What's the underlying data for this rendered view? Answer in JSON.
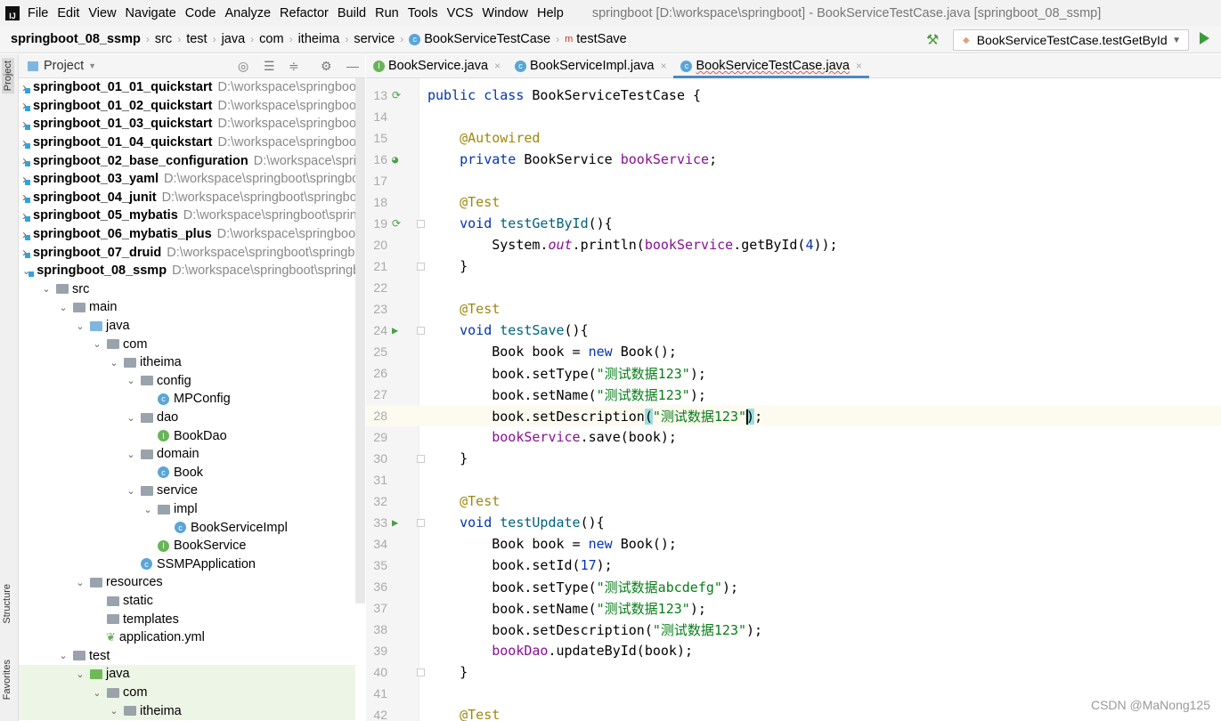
{
  "menubar": {
    "items": [
      "File",
      "Edit",
      "View",
      "Navigate",
      "Code",
      "Analyze",
      "Refactor",
      "Build",
      "Run",
      "Tools",
      "VCS",
      "Window",
      "Help"
    ],
    "title": "springboot [D:\\workspace\\springboot] - BookServiceTestCase.java [springboot_08_ssmp]"
  },
  "breadcrumb": [
    "springboot_08_ssmp",
    "src",
    "test",
    "java",
    "com",
    "itheima",
    "service",
    "BookServiceTestCase",
    "testSave"
  ],
  "run_config": "BookServiceTestCase.testGetById",
  "side_tabs": {
    "project": "Project",
    "structure": "Structure",
    "favorites": "Favorites"
  },
  "project_panel": {
    "title": "Project"
  },
  "tree": [
    {
      "label": "springboot_01_01_quickstart",
      "path": "D:\\workspace\\springboot",
      "depth": 0,
      "exp": false,
      "icon": "mod",
      "bold": true
    },
    {
      "label": "springboot_01_02_quickstart",
      "path": "D:\\workspace\\springboot",
      "depth": 0,
      "exp": false,
      "icon": "mod",
      "bold": true
    },
    {
      "label": "springboot_01_03_quickstart",
      "path": "D:\\workspace\\springboot",
      "depth": 0,
      "exp": false,
      "icon": "mod",
      "bold": true
    },
    {
      "label": "springboot_01_04_quickstart",
      "path": "D:\\workspace\\springboot",
      "depth": 0,
      "exp": false,
      "icon": "mod",
      "bold": true
    },
    {
      "label": "springboot_02_base_configuration",
      "path": "D:\\workspace\\springboot",
      "depth": 0,
      "exp": false,
      "icon": "mod",
      "bold": true
    },
    {
      "label": "springboot_03_yaml",
      "path": "D:\\workspace\\springboot\\springboot",
      "depth": 0,
      "exp": false,
      "icon": "mod",
      "bold": true
    },
    {
      "label": "springboot_04_junit",
      "path": "D:\\workspace\\springboot\\springboot",
      "depth": 0,
      "exp": false,
      "icon": "mod",
      "bold": true
    },
    {
      "label": "springboot_05_mybatis",
      "path": "D:\\workspace\\springboot\\springboot",
      "depth": 0,
      "exp": false,
      "icon": "mod",
      "bold": true
    },
    {
      "label": "springboot_06_mybatis_plus",
      "path": "D:\\workspace\\springboot",
      "depth": 0,
      "exp": false,
      "icon": "mod",
      "bold": true
    },
    {
      "label": "springboot_07_druid",
      "path": "D:\\workspace\\springboot\\springboot",
      "depth": 0,
      "exp": false,
      "icon": "mod",
      "bold": true
    },
    {
      "label": "springboot_08_ssmp",
      "path": "D:\\workspace\\springboot\\springboot",
      "depth": 0,
      "exp": true,
      "icon": "mod",
      "bold": true
    },
    {
      "label": "src",
      "depth": 1,
      "exp": true,
      "icon": "folder"
    },
    {
      "label": "main",
      "depth": 2,
      "exp": true,
      "icon": "folder"
    },
    {
      "label": "java",
      "depth": 3,
      "exp": true,
      "icon": "src"
    },
    {
      "label": "com",
      "depth": 4,
      "exp": true,
      "icon": "folder"
    },
    {
      "label": "itheima",
      "depth": 5,
      "exp": true,
      "icon": "folder"
    },
    {
      "label": "config",
      "depth": 6,
      "exp": true,
      "icon": "folder"
    },
    {
      "label": "MPConfig",
      "depth": 7,
      "icon": "class"
    },
    {
      "label": "dao",
      "depth": 6,
      "exp": true,
      "icon": "folder"
    },
    {
      "label": "BookDao",
      "depth": 7,
      "icon": "interface"
    },
    {
      "label": "domain",
      "depth": 6,
      "exp": true,
      "icon": "folder"
    },
    {
      "label": "Book",
      "depth": 7,
      "icon": "class"
    },
    {
      "label": "service",
      "depth": 6,
      "exp": true,
      "icon": "folder"
    },
    {
      "label": "impl",
      "depth": 7,
      "exp": true,
      "icon": "folder"
    },
    {
      "label": "BookServiceImpl",
      "depth": 8,
      "icon": "class"
    },
    {
      "label": "BookService",
      "depth": 7,
      "icon": "interface"
    },
    {
      "label": "SSMPApplication",
      "depth": 6,
      "icon": "class"
    },
    {
      "label": "resources",
      "depth": 3,
      "exp": true,
      "icon": "folder"
    },
    {
      "label": "static",
      "depth": 4,
      "icon": "folder"
    },
    {
      "label": "templates",
      "depth": 4,
      "icon": "folder"
    },
    {
      "label": "application.yml",
      "depth": 4,
      "icon": "yml"
    },
    {
      "label": "test",
      "depth": 2,
      "exp": true,
      "icon": "folder"
    },
    {
      "label": "java",
      "depth": 3,
      "exp": true,
      "icon": "test",
      "green": true
    },
    {
      "label": "com",
      "depth": 4,
      "exp": true,
      "icon": "folder",
      "green": true
    },
    {
      "label": "itheima",
      "depth": 5,
      "exp": true,
      "icon": "folder",
      "green": true
    }
  ],
  "tabs": [
    {
      "label": "BookService.java",
      "icon": "interface"
    },
    {
      "label": "BookServiceImpl.java",
      "icon": "class"
    },
    {
      "label": "BookServiceTestCase.java",
      "icon": "class",
      "active": true
    }
  ],
  "code": [
    {
      "n": 13,
      "g": "run",
      "t": [
        [
          "public class ",
          "kw"
        ],
        [
          "BookServiceTestCase {",
          ""
        ]
      ]
    },
    {
      "n": 14,
      "t": []
    },
    {
      "n": 15,
      "t": [
        [
          "    @Autowired",
          "an"
        ]
      ]
    },
    {
      "n": 16,
      "g": "bean",
      "t": [
        [
          "    private ",
          "kw"
        ],
        [
          "BookService ",
          ""
        ],
        [
          "bookService",
          "fd"
        ],
        [
          ";",
          ""
        ]
      ]
    },
    {
      "n": 17,
      "t": []
    },
    {
      "n": 18,
      "t": [
        [
          "    @Test",
          "an"
        ]
      ]
    },
    {
      "n": 19,
      "g": "run",
      "f": 1,
      "t": [
        [
          "    void ",
          "kw"
        ],
        [
          "testGetById",
          "mt"
        ],
        [
          "(){",
          ""
        ]
      ]
    },
    {
      "n": 20,
      "t": [
        [
          "        System.",
          ""
        ],
        [
          "out",
          "it"
        ],
        [
          ".println(",
          ""
        ],
        [
          "bookService",
          "fd"
        ],
        [
          ".getById(",
          ""
        ],
        [
          "4",
          "kw"
        ],
        [
          "));",
          ""
        ]
      ]
    },
    {
      "n": 21,
      "f": 1,
      "t": [
        [
          "    }",
          ""
        ]
      ]
    },
    {
      "n": 22,
      "t": []
    },
    {
      "n": 23,
      "t": [
        [
          "    @Test",
          "an"
        ]
      ]
    },
    {
      "n": 24,
      "g": "play",
      "f": 1,
      "t": [
        [
          "    void ",
          "kw"
        ],
        [
          "testSave",
          "mt"
        ],
        [
          "(){",
          ""
        ]
      ]
    },
    {
      "n": 25,
      "t": [
        [
          "        Book book = ",
          ""
        ],
        [
          "new ",
          "kw"
        ],
        [
          "Book();",
          ""
        ]
      ]
    },
    {
      "n": 26,
      "t": [
        [
          "        book.setType(",
          ""
        ],
        [
          "\"测试数据123\"",
          "st"
        ],
        [
          ");",
          ""
        ]
      ]
    },
    {
      "n": 27,
      "t": [
        [
          "        book.setName(",
          ""
        ],
        [
          "\"测试数据123\"",
          "st"
        ],
        [
          ");",
          ""
        ]
      ]
    },
    {
      "n": 28,
      "cur": true,
      "t": [
        [
          "        book.setDescription",
          ""
        ],
        [
          "(",
          "br"
        ],
        [
          "\"测试数据123\"",
          "st"
        ],
        [
          ")",
          "br"
        ],
        [
          ";",
          ""
        ]
      ]
    },
    {
      "n": 29,
      "t": [
        [
          "        ",
          ""
        ],
        [
          "bookService",
          "fd"
        ],
        [
          ".save(book);",
          ""
        ]
      ]
    },
    {
      "n": 30,
      "f": 1,
      "t": [
        [
          "    }",
          ""
        ]
      ]
    },
    {
      "n": 31,
      "t": []
    },
    {
      "n": 32,
      "t": [
        [
          "    @Test",
          "an"
        ]
      ]
    },
    {
      "n": 33,
      "g": "play",
      "f": 1,
      "t": [
        [
          "    void ",
          "kw"
        ],
        [
          "testUpdate",
          "mt"
        ],
        [
          "(){",
          ""
        ]
      ]
    },
    {
      "n": 34,
      "t": [
        [
          "        Book book = ",
          ""
        ],
        [
          "new ",
          "kw"
        ],
        [
          "Book();",
          ""
        ]
      ]
    },
    {
      "n": 35,
      "t": [
        [
          "        book.setId(",
          ""
        ],
        [
          "17",
          "kw"
        ],
        [
          ");",
          ""
        ]
      ]
    },
    {
      "n": 36,
      "t": [
        [
          "        book.setType(",
          ""
        ],
        [
          "\"测试数据abcdefg\"",
          "st"
        ],
        [
          ");",
          ""
        ]
      ]
    },
    {
      "n": 37,
      "t": [
        [
          "        book.setName(",
          ""
        ],
        [
          "\"测试数据123\"",
          "st"
        ],
        [
          ");",
          ""
        ]
      ]
    },
    {
      "n": 38,
      "t": [
        [
          "        book.setDescription(",
          ""
        ],
        [
          "\"测试数据123\"",
          "st"
        ],
        [
          ");",
          ""
        ]
      ]
    },
    {
      "n": 39,
      "t": [
        [
          "        ",
          ""
        ],
        [
          "bookDao",
          "fd"
        ],
        [
          ".updateById(book);",
          ""
        ]
      ]
    },
    {
      "n": 40,
      "f": 1,
      "t": [
        [
          "    }",
          ""
        ]
      ]
    },
    {
      "n": 41,
      "t": []
    },
    {
      "n": 42,
      "t": [
        [
          "    @Test",
          "an"
        ]
      ]
    }
  ],
  "watermark": "CSDN @MaNong125"
}
